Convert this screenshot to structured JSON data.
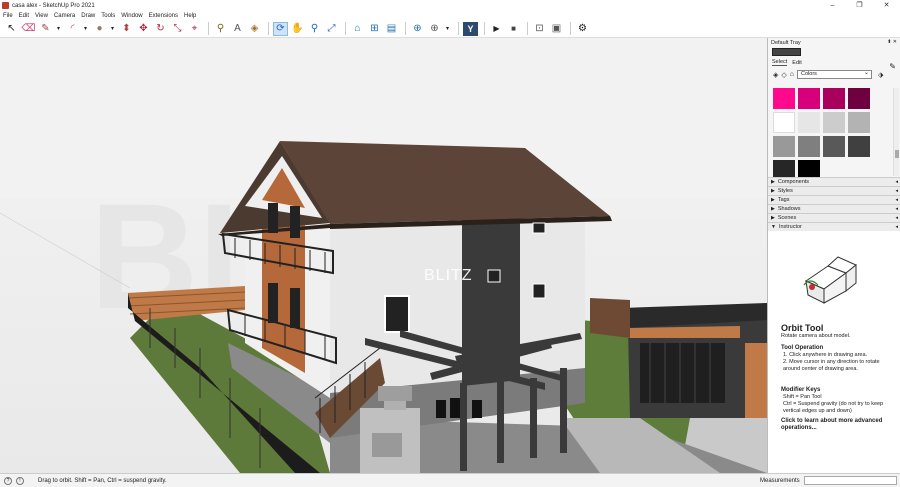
{
  "window": {
    "title": "casa alex - SketchUp Pro 2021",
    "minimize": "–",
    "maximize": "❐",
    "close": "✕"
  },
  "menu": [
    "File",
    "Edit",
    "View",
    "Camera",
    "Draw",
    "Tools",
    "Window",
    "Extensions",
    "Help"
  ],
  "toolbar": {
    "icons": [
      "select-icon",
      "eraser-icon",
      "pencil-line-icon",
      "arc-icon",
      "shape-icon",
      "push-pull-icon",
      "move-icon",
      "rotate-icon",
      "scale-icon",
      "offset-icon",
      "tape-measure-icon",
      "text-icon",
      "paint-bucket-icon",
      "orbit-icon",
      "pan-icon",
      "zoom-icon",
      "zoom-extents-icon",
      "warehouse-icon",
      "extension-warehouse-icon",
      "layout-icon",
      "add-location-icon",
      "instructor-icon",
      "play-icon",
      "stop-icon",
      "scene-icon",
      "settings-icon"
    ],
    "glyphs": {
      "select": "↖",
      "eraser": "⌫",
      "pencil": "✎",
      "dropdown": "▾",
      "arc": "◜",
      "shape": "●",
      "pushpull": "⬍",
      "move": "✥",
      "rotate": "↻",
      "scale": "⤡",
      "offset": "⌖",
      "tape": "⚲",
      "text": "A",
      "paint": "◈",
      "orbit": "⟳",
      "pan": "✋",
      "zoom": "⚲",
      "zoomext": "⤢",
      "warehouse": "⌂",
      "extwh": "⊞",
      "layout": "▤",
      "location": "⊕",
      "instructor": "Y",
      "play": "▶",
      "stop": "■",
      "scene": "⊡",
      "scene2": "▣",
      "settings": "⚙"
    }
  },
  "viewport": {
    "watermark": "BLITZ",
    "model_label": "BLITZ"
  },
  "tray": {
    "title": "Default Tray",
    "pins": "⬍ ✕",
    "tabs": [
      "Select",
      "Edit"
    ],
    "active_tab": "Select",
    "materials_dropdown": "Colors",
    "swatches": [
      "#ff0a8c",
      "#d8007a",
      "#a8005c",
      "#6e0040",
      "#ffffff",
      "#e6e6e6",
      "#cccccc",
      "#b3b3b3",
      "#999999",
      "#7f7f7f",
      "#595959",
      "#404040",
      "#262626",
      "#000000"
    ],
    "panels": [
      "Components",
      "Styles",
      "Tags",
      "Shadows",
      "Scenes",
      "Instructor"
    ],
    "nav": {
      "back": "◈",
      "forward": "◇",
      "home": "⌂"
    }
  },
  "instructor": {
    "title": "Orbit Tool",
    "subtitle": "Rotate camera about model.",
    "op_heading": "Tool Operation",
    "op_1": "1. Click anywhere in drawing area.",
    "op_2": "2. Move cursor in any direction to rotate around center of drawing area.",
    "mod_heading": "Modifier Keys",
    "mod_1": "Shift = Pan Tool",
    "mod_2": "Ctrl = Suspend gravity (do not try to keep vertical edges up and down)",
    "link": "Click to learn about more advanced operations..."
  },
  "statusbar": {
    "icon1": "?",
    "icon2": "!",
    "message": "Drag to orbit. Shift = Pan, Ctrl = suspend gravity.",
    "measurements_label": "Measurements"
  }
}
